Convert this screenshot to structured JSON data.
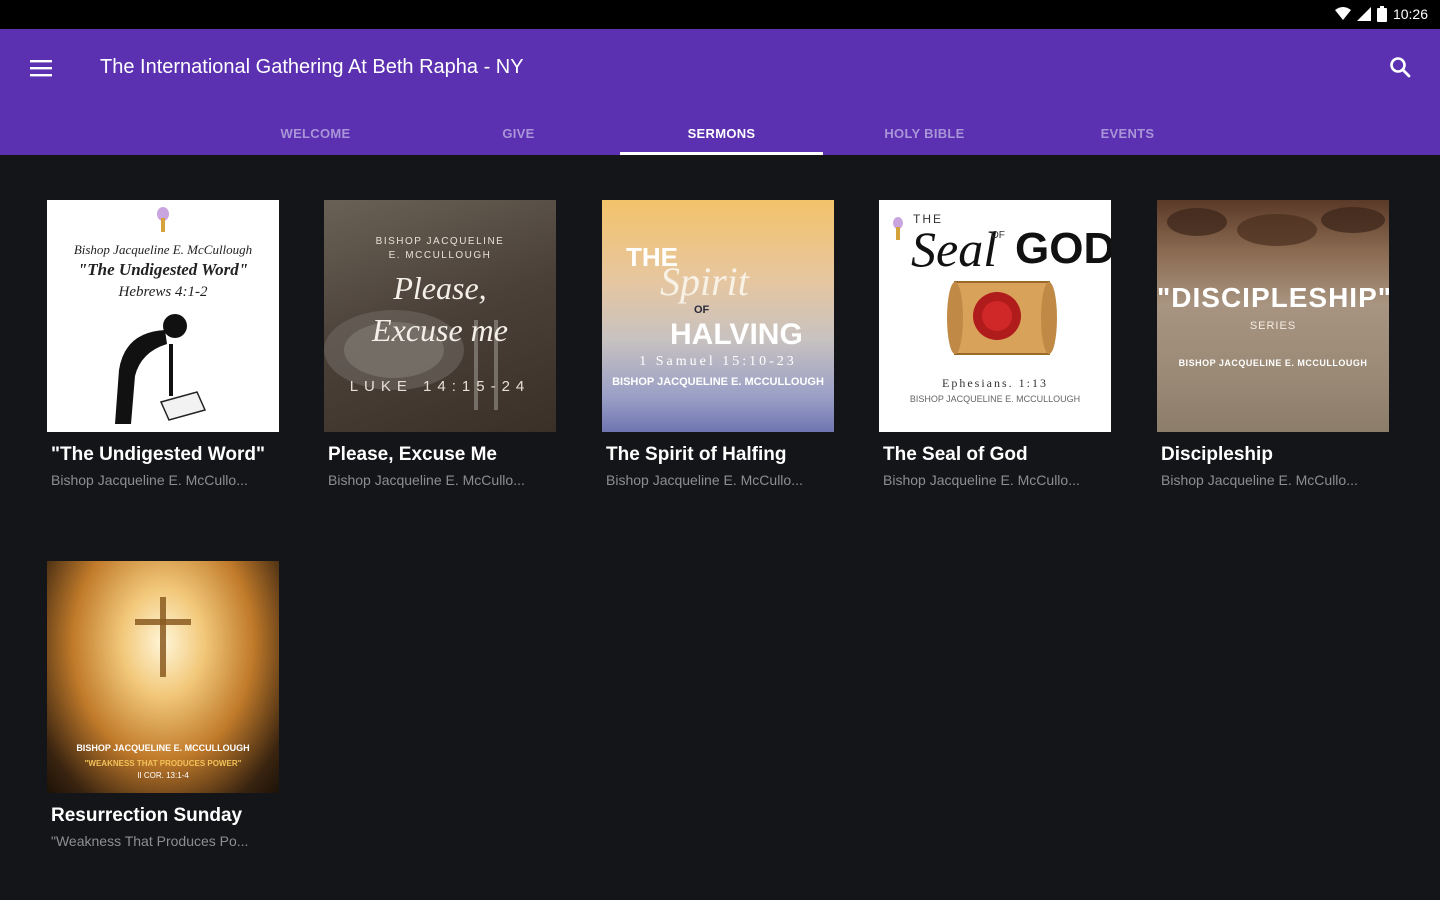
{
  "status": {
    "time": "10:26"
  },
  "header": {
    "title": "The International Gathering At Beth Rapha - NY"
  },
  "tabs": [
    {
      "label": "WELCOME"
    },
    {
      "label": "GIVE"
    },
    {
      "label": "SERMONS"
    },
    {
      "label": "HOLY BIBLE"
    },
    {
      "label": "EVENTS"
    }
  ],
  "active_tab": "SERMONS",
  "sermons": [
    {
      "title": "\"The Undigested Word\"",
      "subtitle": "Bishop Jacqueline E. McCullo...",
      "art": [
        "Bishop Jacqueline E. McCullough",
        "\"The Undigested Word\"",
        "Hebrews 4:1-2"
      ]
    },
    {
      "title": "Please, Excuse Me",
      "subtitle": "Bishop Jacqueline E. McCullo...",
      "art": [
        "BISHOP JACQUELINE",
        "E. MCCULLOUGH",
        "Please,",
        "Excuse me",
        "LUKE 14:15-24"
      ]
    },
    {
      "title": "The Spirit of Halfing",
      "subtitle": "Bishop Jacqueline E. McCullo...",
      "art": [
        "THE",
        "Spirit",
        "OF",
        "HALVING",
        "1 Samuel 15:10-23",
        "BISHOP JACQUELINE E. MCCULLOUGH"
      ]
    },
    {
      "title": "The Seal of God",
      "subtitle": "Bishop Jacqueline E. McCullo...",
      "art": [
        "THE",
        "Seal",
        "OF",
        "GOD",
        "Ephesians. 1:13",
        "BISHOP JACQUELINE E. MCCULLOUGH"
      ]
    },
    {
      "title": "Discipleship",
      "subtitle": "Bishop Jacqueline E. McCullo...",
      "art": [
        "\"DISCIPLESHIP\"",
        "SERIES",
        "BISHOP JACQUELINE E. MCCULLOUGH"
      ]
    },
    {
      "title": "Resurrection Sunday",
      "subtitle": "\"Weakness That Produces Po...",
      "art": [
        "BISHOP JACQUELINE E. MCCULLOUGH",
        "\"WEAKNESS THAT PRODUCES POWER\"",
        "II COR. 13:1-4"
      ]
    }
  ],
  "colors": {
    "appbar": "#5b30b1",
    "background": "#141518",
    "tab_inactive": "#a995d8"
  },
  "icons": {
    "menu": "menu-icon",
    "search": "search-icon",
    "wifi": "wifi-icon",
    "signal": "signal-icon",
    "battery": "battery-icon"
  }
}
